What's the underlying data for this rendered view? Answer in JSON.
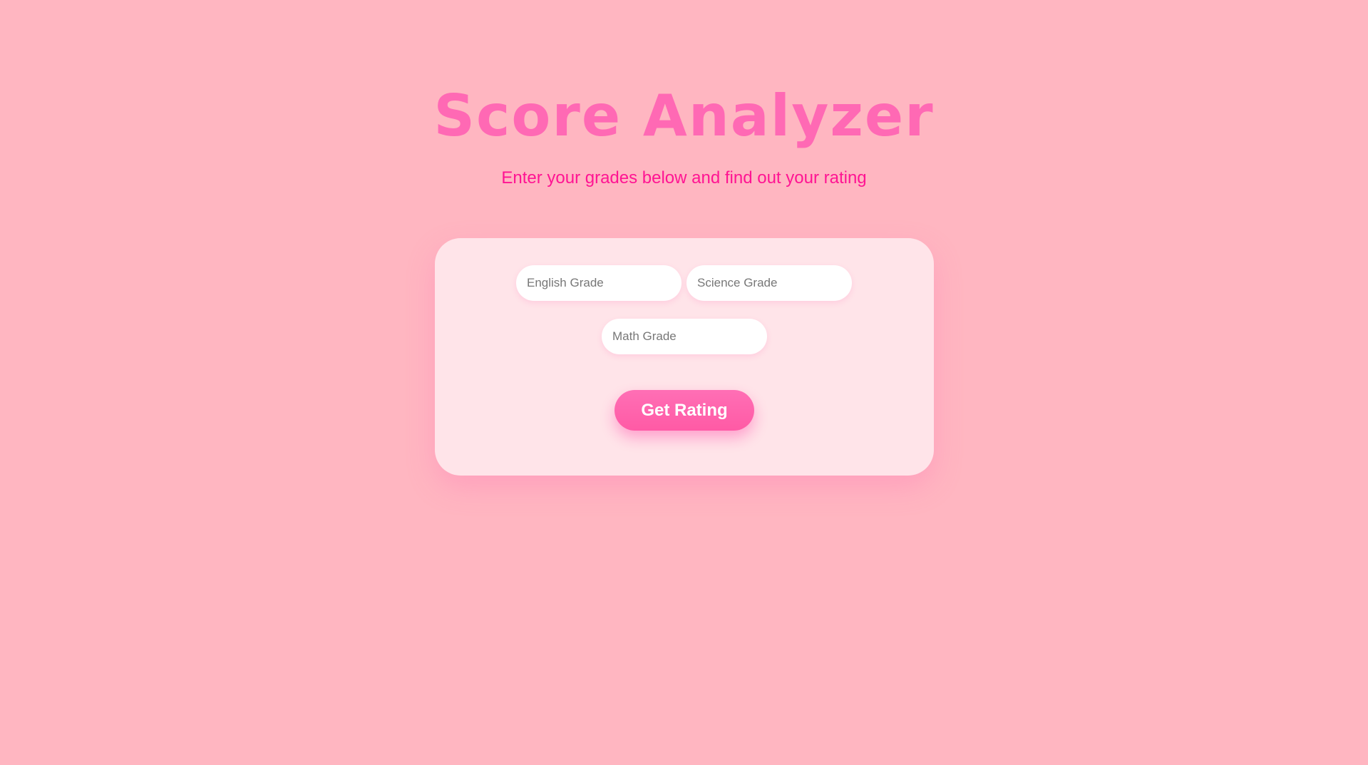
{
  "header": {
    "title": "Score Analyzer",
    "subtitle": "Enter your grades below and find out your rating"
  },
  "form": {
    "english_placeholder": "English Grade",
    "science_placeholder": "Science Grade",
    "math_placeholder": "Math Grade",
    "english_value": "",
    "science_value": "",
    "math_value": "",
    "submit_label": "Get Rating"
  },
  "colors": {
    "background": "#ffb6c1",
    "card": "#ffe4e9",
    "title": "#ff69b4",
    "subtitle": "#ff1493",
    "button": "#ff69b4",
    "button_text": "#ffffff"
  }
}
